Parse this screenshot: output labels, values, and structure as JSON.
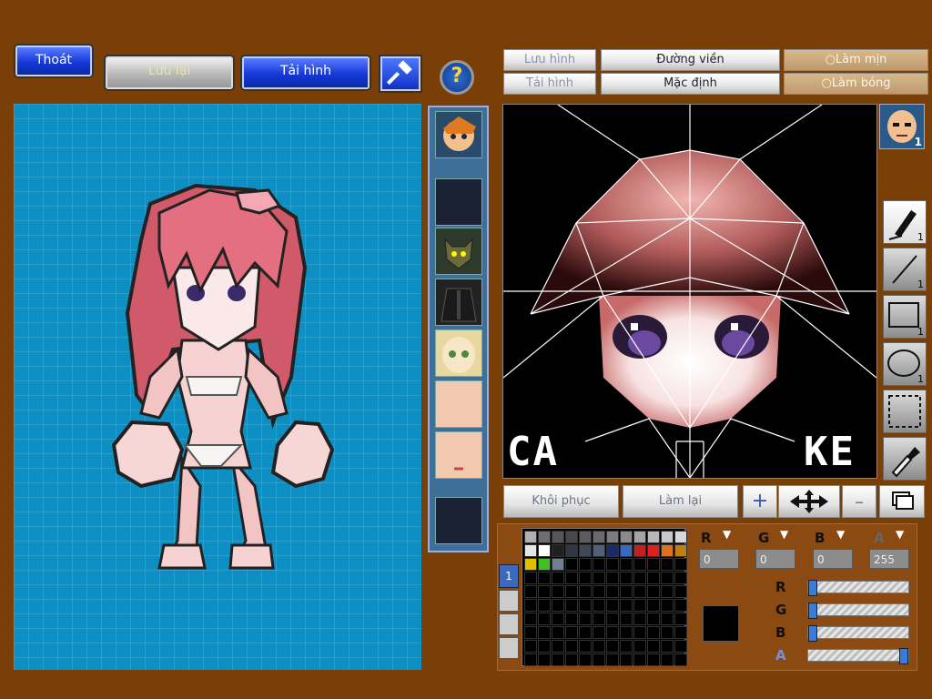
{
  "top_left": {
    "exit_label": "Thoát",
    "save_label": "Lưu lại",
    "load_label": "Tải hình",
    "help_glyph": "?"
  },
  "editor_top": {
    "save_image": "Lưu hình",
    "load_image": "Tải hình",
    "outline": "Đường viền",
    "default": "Mặc định",
    "smooth": "Làm mịn",
    "shiny": "Làm bóng"
  },
  "texture_overlay": {
    "left_text": "CA",
    "right_text": "KE"
  },
  "head_thumb_badge": "1",
  "tools": [
    {
      "name": "pen",
      "count": "1"
    },
    {
      "name": "line",
      "count": "1"
    },
    {
      "name": "rectangle",
      "count": "1"
    },
    {
      "name": "ellipse",
      "count": "1"
    },
    {
      "name": "select",
      "count": ""
    },
    {
      "name": "eyedropper",
      "count": ""
    }
  ],
  "bottom": {
    "restore_label": "Khôi phục",
    "redo_label": "Làm lại",
    "page_label": "1"
  },
  "color": {
    "r_label": "R",
    "g_label": "G",
    "b_label": "B",
    "a_label": "A",
    "r": "0",
    "g": "0",
    "b": "0",
    "a": "255",
    "current": "#000000",
    "slider_fractions": {
      "r": 0.0,
      "g": 0.0,
      "b": 0.0,
      "a": 1.0
    }
  },
  "palette_colors": [
    "#b0b0b0",
    "#6e6e6e",
    "#565656",
    "#484848",
    "#5c5c5c",
    "#6a6a6a",
    "#7c7c7c",
    "#8a8a8a",
    "#a4a4a4",
    "#b8b8b8",
    "#c8c8c8",
    "#d8d8d8",
    "#e6e6e6",
    "#ffffff",
    "#202020",
    "#303846",
    "#404858",
    "#50607a",
    "#1a2a6a",
    "#3a6ac0",
    "#c02020",
    "#e02020",
    "#e07020",
    "#c08010",
    "#e0c000",
    "#40c020",
    "#708090",
    "#000000",
    "#000000",
    "#000000",
    "#000000",
    "#000000",
    "#000000",
    "#000000",
    "#000000",
    "#000000"
  ]
}
